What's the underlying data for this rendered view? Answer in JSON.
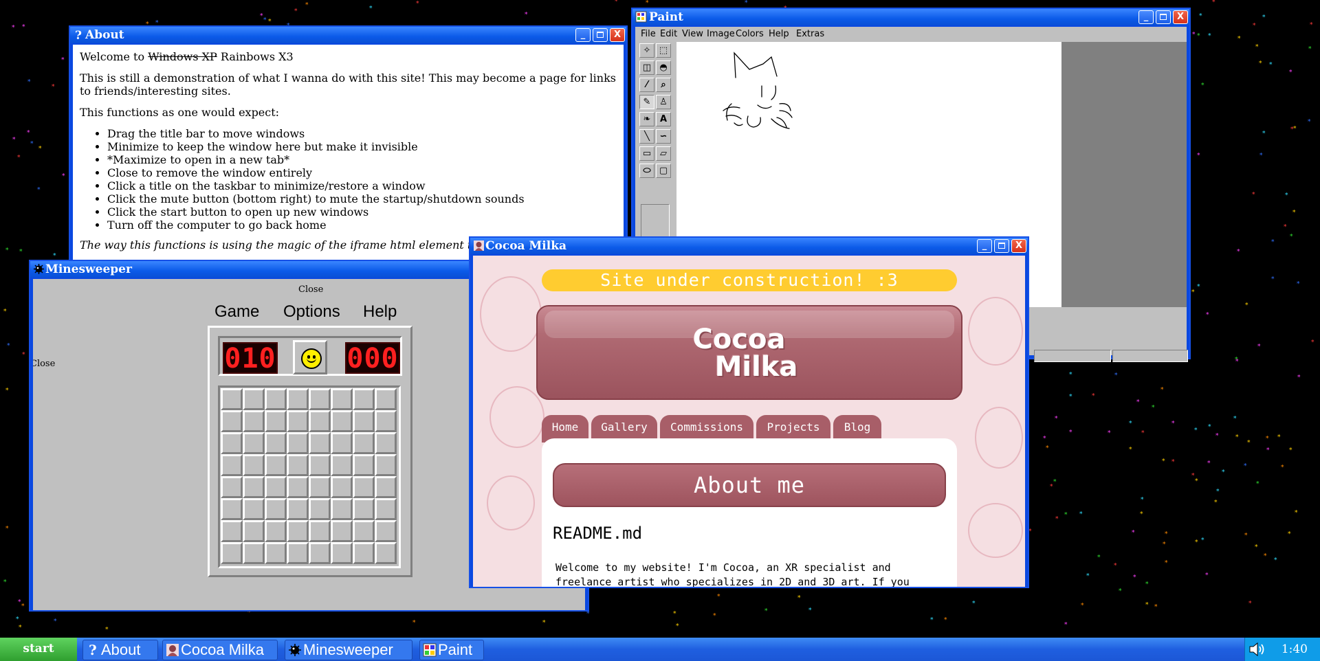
{
  "desktop": {
    "background": "#000000",
    "star_colors": [
      "#ff3b3b",
      "#ffd000",
      "#30e030",
      "#3070ff",
      "#ff40ff",
      "#30e0ff",
      "#ff8a00"
    ]
  },
  "about_window": {
    "title": "About",
    "welcome_prefix": "Welcome to ",
    "welcome_struck": "Windows XP",
    "welcome_suffix": " Rainbows X3",
    "para1": "This is still a demonstration of what I wanna do with this site! This may become a page for links to friends/interesting sites.",
    "para2": "This functions as one would expect:",
    "items": [
      "Drag the title bar to move windows",
      "Minimize to keep the window here but make it invisible",
      "*Maximize to open in a new tab*",
      "Close to remove the window entirely",
      "Click a title on the taskbar to minimize/restore a window",
      "Click the mute button (bottom right) to mute the startup/shutdown sounds",
      "Click the start button to open up new windows",
      "Turn off the computer to go back home"
    ],
    "para3_partial": "The way this functions is using the magic of the iframe html element t"
  },
  "window_buttons": {
    "minimize": "_",
    "close": "X"
  },
  "paint_window": {
    "title": "Paint",
    "menu": [
      "File",
      "Edit",
      "View",
      "Image",
      "Colors",
      "Help",
      "Extras"
    ],
    "tools": [
      "free-select",
      "rect-select",
      "eraser",
      "fill",
      "picker",
      "magnifier",
      "pencil",
      "brush",
      "airbrush",
      "text",
      "line",
      "curve",
      "rectangle",
      "polygon",
      "ellipse",
      "rounded-rect"
    ],
    "tool_glyphs": [
      "✧",
      "⬚",
      "◫",
      "◓",
      "⁄",
      "⌕",
      "✎",
      "♙",
      "❧",
      "A",
      "╲",
      "∽",
      "▭",
      "▱",
      "⬭",
      "▢"
    ]
  },
  "minesweeper_window": {
    "title": "Minesweeper",
    "close_label": "Close",
    "close_label_2": "Close",
    "menu": [
      "Game",
      "Options",
      "Help"
    ],
    "mine_counter": "010",
    "timer": "000",
    "grid_size": 8
  },
  "cocoa_window": {
    "title": "Cocoa Milka",
    "banner": "Site under construction! :3",
    "logo_line1": "Cocoa",
    "logo_line2": "Milka",
    "tabs": [
      "Home",
      "Gallery",
      "Commissions",
      "Projects",
      "Blog"
    ],
    "about_heading": "About me",
    "readme_title": "README.md",
    "readme_text": "Welcome to my website! I'm Cocoa, an XR specialist and freelance artist who specializes in 2D and 3D art. If you",
    "colors": {
      "accent": "#a85e68",
      "banner": "#ffcc30",
      "background": "#f5dfe2"
    }
  },
  "taskbar": {
    "start_label": "start",
    "tasks": [
      "About",
      "Cocoa Milka",
      "Minesweeper",
      "Paint"
    ],
    "clock": "1:40"
  }
}
